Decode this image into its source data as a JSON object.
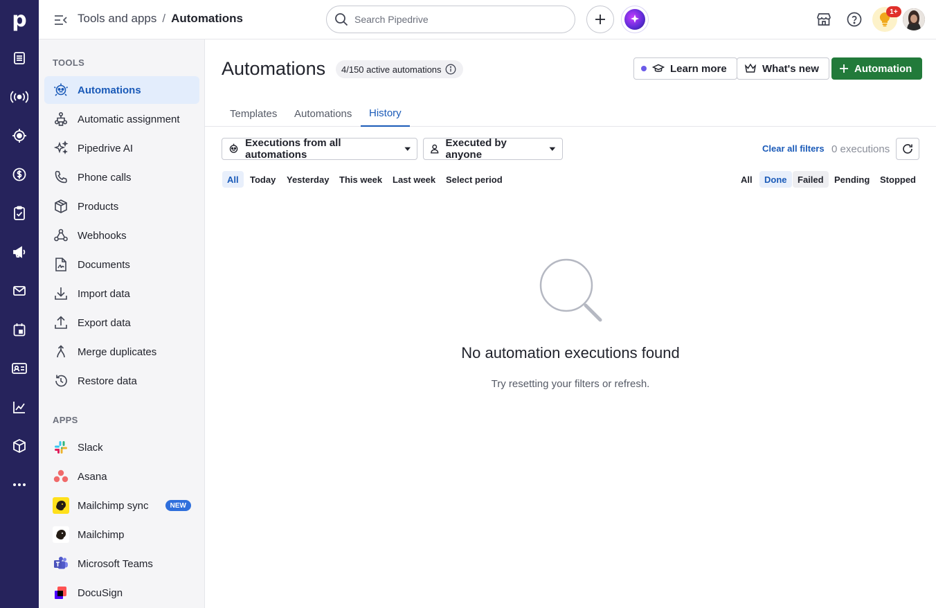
{
  "rail": {
    "logo": "p",
    "items": [
      "deals-icon",
      "leads-icon",
      "target-icon",
      "dollar-icon",
      "tasks-icon",
      "campaigns-icon",
      "mail-icon",
      "calendar-icon",
      "contacts-icon",
      "insights-icon",
      "products-icon",
      "more-icon"
    ]
  },
  "header": {
    "breadcrumb_parent": "Tools and apps",
    "breadcrumb_sep": "/",
    "breadcrumb_current": "Automations",
    "search_placeholder": "Search Pipedrive",
    "notification_badge": "1+"
  },
  "sidebar": {
    "tools_title": "TOOLS",
    "tools": [
      {
        "label": "Automations",
        "icon": "robot-icon",
        "active": true
      },
      {
        "label": "Automatic assignment",
        "icon": "assignment-icon"
      },
      {
        "label": "Pipedrive AI",
        "icon": "sparkle-icon"
      },
      {
        "label": "Phone calls",
        "icon": "phone-icon"
      },
      {
        "label": "Products",
        "icon": "box-icon"
      },
      {
        "label": "Webhooks",
        "icon": "webhook-icon"
      },
      {
        "label": "Documents",
        "icon": "document-icon"
      },
      {
        "label": "Import data",
        "icon": "download-icon"
      },
      {
        "label": "Export data",
        "icon": "upload-icon"
      },
      {
        "label": "Merge duplicates",
        "icon": "merge-icon"
      },
      {
        "label": "Restore data",
        "icon": "restore-icon"
      }
    ],
    "apps_title": "APPS",
    "apps": [
      {
        "label": "Slack",
        "icon": "slack-icon"
      },
      {
        "label": "Asana",
        "icon": "asana-icon"
      },
      {
        "label": "Mailchimp sync",
        "icon": "mailchimp-icon",
        "badge": "NEW"
      },
      {
        "label": "Mailchimp",
        "icon": "mailchimp-icon"
      },
      {
        "label": "Microsoft Teams",
        "icon": "teams-icon"
      },
      {
        "label": "DocuSign",
        "icon": "docusign-icon"
      }
    ]
  },
  "main": {
    "title": "Automations",
    "active_count": "4/150 active automations",
    "learn_more": "Learn more",
    "whats_new": "What's new",
    "add_automation": "Automation",
    "tabs": [
      "Templates",
      "Automations",
      "History"
    ],
    "active_tab": "History",
    "filter_automations": "Executions from all automations",
    "filter_users": "Executed by anyone",
    "clear_filters": "Clear all filters",
    "executions_count": "0 executions",
    "period_filters": [
      "All",
      "Today",
      "Yesterday",
      "This week",
      "Last week",
      "Select period"
    ],
    "status_filters": [
      "All",
      "Done",
      "Failed",
      "Pending",
      "Stopped"
    ],
    "empty_title": "No automation executions found",
    "empty_subtitle": "Try resetting your filters or refresh."
  },
  "colors": {
    "rail_bg": "#26235c",
    "accent_blue": "#1a5ab8",
    "primary_green": "#227a3a",
    "sidebar_bg": "#f5f5f7"
  }
}
